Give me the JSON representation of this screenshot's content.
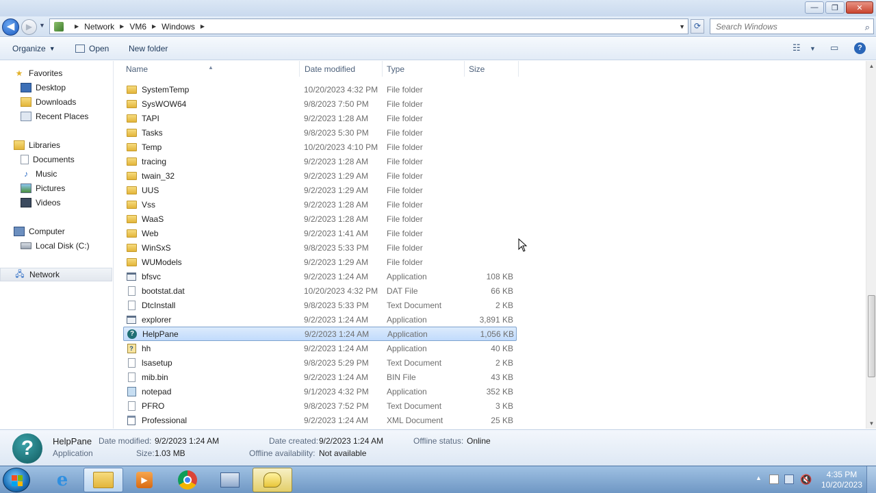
{
  "window": {
    "minimize": "—",
    "maximize": "❐",
    "close": "✕"
  },
  "address": {
    "breadcrumbs": [
      "Network",
      "VM6",
      "Windows"
    ],
    "search_placeholder": "Search Windows"
  },
  "toolbar": {
    "organize": "Organize",
    "open": "Open",
    "new_folder": "New folder"
  },
  "navpane": {
    "favorites": "Favorites",
    "desktop": "Desktop",
    "downloads": "Downloads",
    "recent_places": "Recent Places",
    "libraries": "Libraries",
    "documents": "Documents",
    "music": "Music",
    "pictures": "Pictures",
    "videos": "Videos",
    "computer": "Computer",
    "local_disk": "Local Disk (C:)",
    "network": "Network"
  },
  "columns": {
    "name": "Name",
    "date": "Date modified",
    "type": "Type",
    "size": "Size"
  },
  "files": [
    {
      "name": "SystemTemp",
      "date": "10/20/2023 4:32 PM",
      "type": "File folder",
      "size": "",
      "icon": "folder"
    },
    {
      "name": "SysWOW64",
      "date": "9/8/2023 7:50 PM",
      "type": "File folder",
      "size": "",
      "icon": "folder"
    },
    {
      "name": "TAPI",
      "date": "9/2/2023 1:28 AM",
      "type": "File folder",
      "size": "",
      "icon": "folder"
    },
    {
      "name": "Tasks",
      "date": "9/8/2023 5:30 PM",
      "type": "File folder",
      "size": "",
      "icon": "folder"
    },
    {
      "name": "Temp",
      "date": "10/20/2023 4:10 PM",
      "type": "File folder",
      "size": "",
      "icon": "folder"
    },
    {
      "name": "tracing",
      "date": "9/2/2023 1:28 AM",
      "type": "File folder",
      "size": "",
      "icon": "folder"
    },
    {
      "name": "twain_32",
      "date": "9/2/2023 1:29 AM",
      "type": "File folder",
      "size": "",
      "icon": "folder"
    },
    {
      "name": "UUS",
      "date": "9/2/2023 1:29 AM",
      "type": "File folder",
      "size": "",
      "icon": "folder"
    },
    {
      "name": "Vss",
      "date": "9/2/2023 1:28 AM",
      "type": "File folder",
      "size": "",
      "icon": "folder"
    },
    {
      "name": "WaaS",
      "date": "9/2/2023 1:28 AM",
      "type": "File folder",
      "size": "",
      "icon": "folder"
    },
    {
      "name": "Web",
      "date": "9/2/2023 1:41 AM",
      "type": "File folder",
      "size": "",
      "icon": "folder"
    },
    {
      "name": "WinSxS",
      "date": "9/8/2023 5:33 PM",
      "type": "File folder",
      "size": "",
      "icon": "folder"
    },
    {
      "name": "WUModels",
      "date": "9/2/2023 1:29 AM",
      "type": "File folder",
      "size": "",
      "icon": "folder"
    },
    {
      "name": "bfsvc",
      "date": "9/2/2023 1:24 AM",
      "type": "Application",
      "size": "108 KB",
      "icon": "app"
    },
    {
      "name": "bootstat.dat",
      "date": "10/20/2023 4:32 PM",
      "type": "DAT File",
      "size": "66 KB",
      "icon": "doc"
    },
    {
      "name": "DtcInstall",
      "date": "9/8/2023 5:33 PM",
      "type": "Text Document",
      "size": "2 KB",
      "icon": "doc"
    },
    {
      "name": "explorer",
      "date": "9/2/2023 1:24 AM",
      "type": "Application",
      "size": "3,891 KB",
      "icon": "app"
    },
    {
      "name": "HelpPane",
      "date": "9/2/2023 1:24 AM",
      "type": "Application",
      "size": "1,056 KB",
      "icon": "help"
    },
    {
      "name": "hh",
      "date": "9/2/2023 1:24 AM",
      "type": "Application",
      "size": "40 KB",
      "icon": "hh"
    },
    {
      "name": "lsasetup",
      "date": "9/8/2023 5:29 PM",
      "type": "Text Document",
      "size": "2 KB",
      "icon": "doc"
    },
    {
      "name": "mib.bin",
      "date": "9/2/2023 1:24 AM",
      "type": "BIN File",
      "size": "43 KB",
      "icon": "doc"
    },
    {
      "name": "notepad",
      "date": "9/1/2023 4:32 PM",
      "type": "Application",
      "size": "352 KB",
      "icon": "note"
    },
    {
      "name": "PFRO",
      "date": "9/8/2023 7:52 PM",
      "type": "Text Document",
      "size": "3 KB",
      "icon": "doc"
    },
    {
      "name": "Professional",
      "date": "9/2/2023 1:24 AM",
      "type": "XML Document",
      "size": "25 KB",
      "icon": "xml"
    }
  ],
  "selected_index": 17,
  "details": {
    "name": "HelpPane",
    "kind": "Application",
    "date_modified_label": "Date modified:",
    "date_modified": "9/2/2023 1:24 AM",
    "size_label": "Size:",
    "size": "1.03 MB",
    "date_created_label": "Date created:",
    "date_created": "9/2/2023 1:24 AM",
    "offline_avail_label": "Offline availability:",
    "offline_avail": "Not available",
    "offline_status_label": "Offline status:",
    "offline_status": "Online"
  },
  "clock": {
    "time": "4:35 PM",
    "date": "10/20/2023"
  },
  "colors": {
    "selection": "#c1dbfc",
    "accent": "#1c5bbf"
  }
}
